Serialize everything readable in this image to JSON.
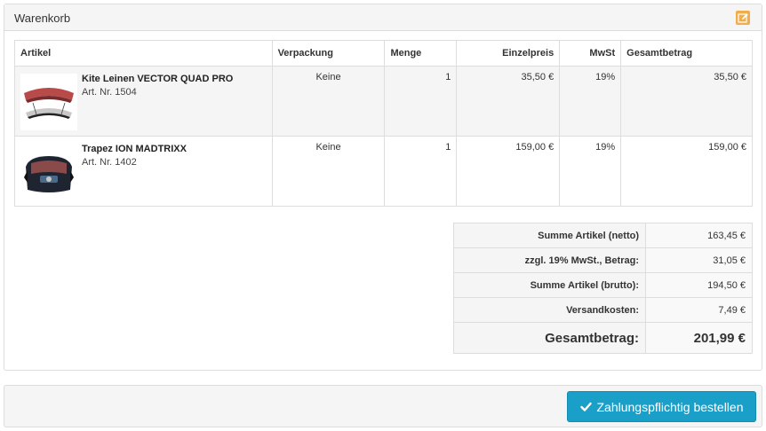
{
  "cart": {
    "title": "Warenkorb",
    "edit_icon": "pencil-square-icon",
    "columns": [
      "Artikel",
      "Verpackung",
      "Menge",
      "Einzelpreis",
      "MwSt",
      "Gesamtbetrag"
    ],
    "items": [
      {
        "name": "Kite Leinen VECTOR QUAD PRO",
        "art_nr": "Art. Nr. 1504",
        "packaging": "Keine",
        "quantity": "1",
        "unit_price": "35,50 €",
        "vat": "19%",
        "total": "35,50 €",
        "image_icon": "kite-lines-product-image"
      },
      {
        "name": "Trapez ION MADTRIXX",
        "art_nr": "Art. Nr. 1402",
        "packaging": "Keine",
        "quantity": "1",
        "unit_price": "159,00 €",
        "vat": "19%",
        "total": "159,00 €",
        "image_icon": "harness-product-image"
      }
    ],
    "totals": [
      {
        "label": "Summe Artikel (netto)",
        "value": "163,45 €"
      },
      {
        "label": "zzgl. 19% MwSt., Betrag:",
        "value": "31,05 €"
      },
      {
        "label": "Summe Artikel (brutto):",
        "value": "194,50 €"
      },
      {
        "label": "Versandkosten:",
        "value": "7,49 €"
      }
    ],
    "grand_total": {
      "label": "Gesamtbetrag:",
      "value": "201,99 €"
    }
  },
  "footer": {
    "order_button_label": "Zahlungspflichtig bestellen",
    "order_button_icon": "check-icon"
  },
  "colors": {
    "accent": "#1a9fc9",
    "edit": "#f0ad4e",
    "row_shade": "#f5f5f5",
    "border": "#dddddd"
  }
}
